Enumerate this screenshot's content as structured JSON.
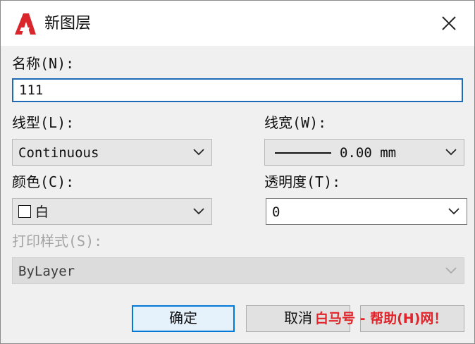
{
  "window": {
    "title": "新图层",
    "close_label": "×"
  },
  "name": {
    "label": "名称(N):",
    "value": "111"
  },
  "linetype": {
    "label": "线型(L):",
    "selected": "Continuous"
  },
  "lineweight": {
    "label": "线宽(W):",
    "selected": "0.00 mm"
  },
  "color": {
    "label": "颜色(C):",
    "selected": "白"
  },
  "transparency": {
    "label": "透明度(T):",
    "selected": "0"
  },
  "plotstyle": {
    "label": "打印样式(S):",
    "selected": "ByLayer"
  },
  "buttons": {
    "ok": "确定",
    "cancel": "取消"
  },
  "watermark": "白马号 - 帮助(H)网！",
  "colors": {
    "accent": "#0078d7",
    "focus": "#1d6ab8",
    "logo": "#d9262c"
  }
}
